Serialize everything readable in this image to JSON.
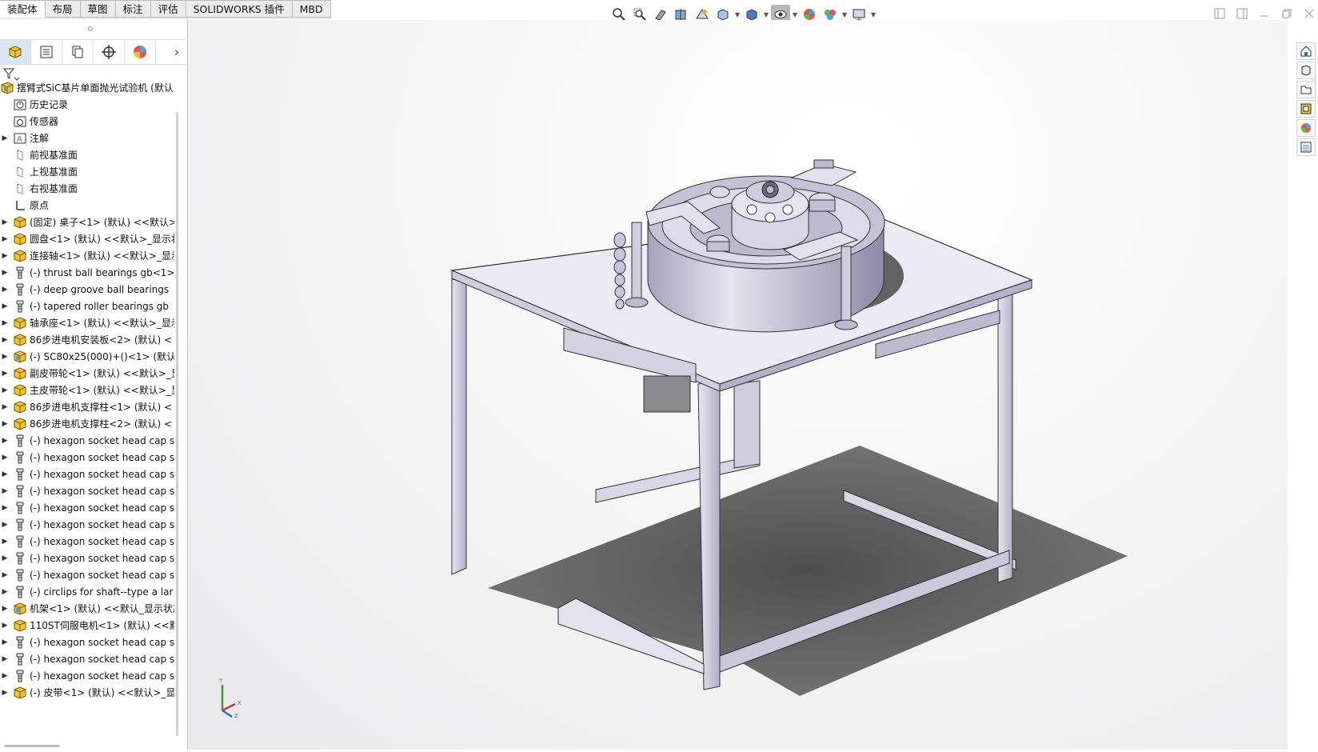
{
  "tabs": [
    {
      "label": "装配体",
      "active": true
    },
    {
      "label": "布局"
    },
    {
      "label": "草图"
    },
    {
      "label": "标注"
    },
    {
      "label": "评估"
    },
    {
      "label": "SOLIDWORKS 插件"
    },
    {
      "label": "MBD"
    }
  ],
  "hud_icons": [
    "zoom-to-fit-icon",
    "zoom-to-area-icon",
    "previous-view-icon",
    "section-view-icon",
    "dynamic-annotation-icon",
    "view-orientation-icon",
    "display-style-icon",
    "hide-show-items-icon",
    "edit-appearance-icon",
    "apply-scene-icon",
    "view-settings-icon"
  ],
  "manager_tabs": [
    "featuremanager-icon",
    "propertymanager-icon",
    "configurationmanager-icon",
    "dimxpertmanager-icon",
    "displaymanager-icon"
  ],
  "tree": {
    "root": "摆臂式SiC基片单面抛光试验机 (默认)",
    "items": [
      {
        "label": "历史记录",
        "icon": "history-icon",
        "expandable": false
      },
      {
        "label": "传感器",
        "icon": "sensor-icon",
        "expandable": false
      },
      {
        "label": "注解",
        "icon": "annotation-icon",
        "expandable": true
      },
      {
        "label": "前视基准面",
        "icon": "plane-icon",
        "expandable": false
      },
      {
        "label": "上视基准面",
        "icon": "plane-icon",
        "expandable": false
      },
      {
        "label": "右视基准面",
        "icon": "plane-icon",
        "expandable": false
      },
      {
        "label": "原点",
        "icon": "origin-icon",
        "expandable": false
      },
      {
        "label": "(固定) 桌子<1> (默认) <<默认>",
        "icon": "subassembly-icon",
        "expandable": true
      },
      {
        "label": "圆盘<1> (默认) <<默认>_显示状",
        "icon": "subassembly-icon",
        "expandable": true
      },
      {
        "label": "连接轴<1> (默认) <<默认>_显示",
        "icon": "subassembly-icon",
        "expandable": true
      },
      {
        "label": "(-) thrust ball bearings gb<1>",
        "icon": "toolbox-part-icon",
        "expandable": true
      },
      {
        "label": "(-) deep groove ball bearings",
        "icon": "toolbox-part-icon",
        "expandable": true
      },
      {
        "label": "(-) tapered roller bearings gb",
        "icon": "toolbox-part-icon",
        "expandable": true
      },
      {
        "label": "轴承座<1> (默认) <<默认>_显示",
        "icon": "subassembly-icon",
        "expandable": true
      },
      {
        "label": "86步进电机安装板<2> (默认) <",
        "icon": "subassembly-icon",
        "expandable": true
      },
      {
        "label": "(-) SC80x25(000)+()<1> (默认)",
        "icon": "subassembly-blue-icon",
        "expandable": true
      },
      {
        "label": "副皮带轮<1> (默认) <<默认>_显",
        "icon": "subassembly-icon",
        "expandable": true
      },
      {
        "label": "主皮带轮<1> (默认) <<默认>_显",
        "icon": "subassembly-icon",
        "expandable": true
      },
      {
        "label": "86步进电机支撑柱<1> (默认) <",
        "icon": "subassembly-icon",
        "expandable": true
      },
      {
        "label": "86步进电机支撑柱<2> (默认) <",
        "icon": "subassembly-icon",
        "expandable": true
      },
      {
        "label": "(-) hexagon socket head cap s",
        "icon": "toolbox-part-icon",
        "expandable": true
      },
      {
        "label": "(-) hexagon socket head cap s",
        "icon": "toolbox-part-icon",
        "expandable": true
      },
      {
        "label": "(-) hexagon socket head cap s",
        "icon": "toolbox-part-icon",
        "expandable": true
      },
      {
        "label": "(-) hexagon socket head cap s",
        "icon": "toolbox-part-icon",
        "expandable": true
      },
      {
        "label": "(-) hexagon socket head cap s",
        "icon": "toolbox-part-icon",
        "expandable": true
      },
      {
        "label": "(-) hexagon socket head cap s",
        "icon": "toolbox-part-icon",
        "expandable": true
      },
      {
        "label": "(-) hexagon socket head cap s",
        "icon": "toolbox-part-icon",
        "expandable": true
      },
      {
        "label": "(-) hexagon socket head cap s",
        "icon": "toolbox-part-icon",
        "expandable": true
      },
      {
        "label": "(-) hexagon socket head cap s",
        "icon": "toolbox-part-icon",
        "expandable": true
      },
      {
        "label": "(-) circlips for shaft--type a lar",
        "icon": "toolbox-part-icon",
        "expandable": true
      },
      {
        "label": "机架<1> (默认) <<默认_显示状态",
        "icon": "subassembly-blue-icon",
        "expandable": true
      },
      {
        "label": "110ST伺服电机<1> (默认) <<默",
        "icon": "subassembly-icon",
        "expandable": true
      },
      {
        "label": "(-) hexagon socket head cap s",
        "icon": "toolbox-part-icon",
        "expandable": true
      },
      {
        "label": "(-) hexagon socket head cap s",
        "icon": "toolbox-part-icon",
        "expandable": true
      },
      {
        "label": "(-) hexagon socket head cap s",
        "icon": "toolbox-part-icon",
        "expandable": true
      },
      {
        "label": "(-) 皮带<1> (默认) <<默认>_显",
        "icon": "subassembly-icon",
        "expandable": true
      }
    ]
  },
  "task_pane": [
    "home-icon",
    "design-library-icon",
    "file-explorer-icon",
    "view-palette-icon",
    "appearances-icon",
    "custom-properties-icon"
  ],
  "triad": {
    "x": "X",
    "y": "Y",
    "z": "Z"
  },
  "colors": {
    "accent_blue": "#2f6fb5",
    "part_fill": "#c9c6dc",
    "part_edge": "#3a3a46"
  }
}
